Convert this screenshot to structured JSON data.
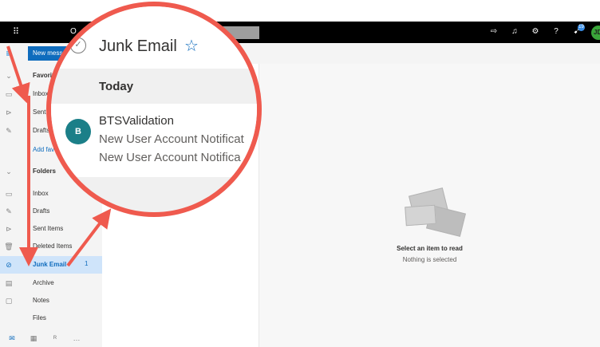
{
  "topbar": {
    "app_letter": "O",
    "avatar_initials": "JD",
    "badge_count": "19",
    "icons": [
      "waffle-icon",
      "send-icon",
      "bell-icon",
      "gear-icon",
      "help-icon",
      "megaphone-icon"
    ]
  },
  "commandbar": {
    "new_message": "New message",
    "ghost_text": "o"
  },
  "nav": {
    "favorites_label": "Favorites",
    "favorites_items": [
      {
        "label": "Inbox",
        "icon": "inbox-icon"
      },
      {
        "label": "Sent Items",
        "icon": "send-icon"
      },
      {
        "label": "Drafts",
        "icon": "pencil-icon"
      }
    ],
    "add_favorite": "Add favorite",
    "folders_label": "Folders",
    "folders": [
      {
        "label": "Inbox",
        "icon": "inbox-icon",
        "count": ""
      },
      {
        "label": "Drafts",
        "icon": "pencil-icon",
        "count": ""
      },
      {
        "label": "Sent Items",
        "icon": "send-icon",
        "count": ""
      },
      {
        "label": "Deleted Items",
        "icon": "trash-icon",
        "count": ""
      },
      {
        "label": "Junk Email",
        "icon": "blocked-icon",
        "count": "1",
        "selected": true
      },
      {
        "label": "Archive",
        "icon": "archive-icon",
        "count": ""
      },
      {
        "label": "Notes",
        "icon": "note-icon",
        "count": ""
      },
      {
        "label": "Files",
        "icon": "",
        "count": ""
      }
    ]
  },
  "magnifier": {
    "folder_title": "Junk Email",
    "group_label": "Today",
    "sender_initial": "B",
    "sender": "BTSValidation",
    "subject": "New User Account Notificat",
    "preview": "New User Account Notifica"
  },
  "reading_pane": {
    "title": "Select an item to read",
    "subtitle": "Nothing is selected"
  },
  "colors": {
    "accent": "#0f6cbd",
    "annotation": "#ef5a4e",
    "avatar": "#1b7f88"
  }
}
